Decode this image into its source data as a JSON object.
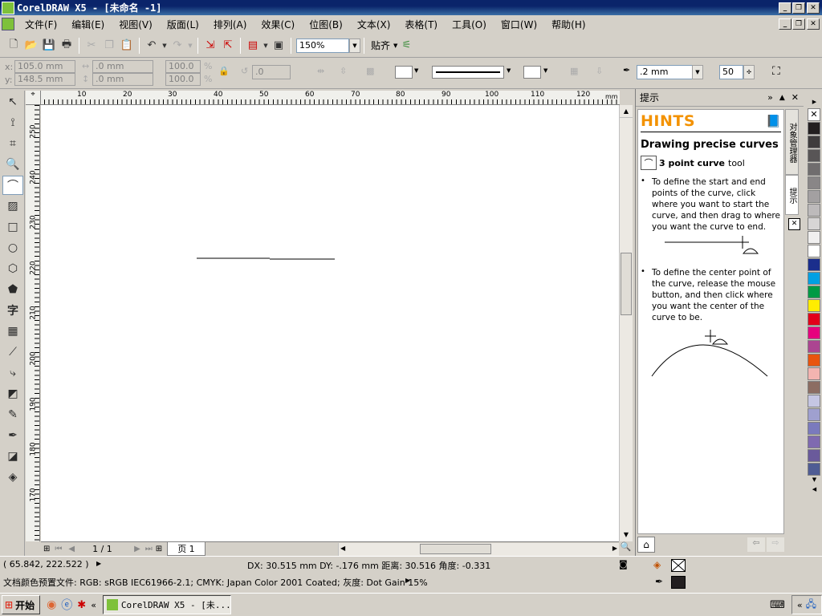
{
  "window": {
    "title": "CorelDRAW X5 - [未命名 -1]"
  },
  "menu": [
    "文件(F)",
    "编辑(E)",
    "视图(V)",
    "版面(L)",
    "排列(A)",
    "效果(C)",
    "位图(B)",
    "文本(X)",
    "表格(T)",
    "工具(O)",
    "窗口(W)",
    "帮助(H)"
  ],
  "toolbar": {
    "zoom": "150%",
    "snap_label": "贴齐"
  },
  "propbar": {
    "x_label": "x:",
    "x": "105.0 mm",
    "y_label": "y:",
    "y": "148.5 mm",
    "w": ".0 mm",
    "h": ".0 mm",
    "sx": "100.0",
    "sy": "100.0",
    "pct": "%",
    "angle": ".0",
    "outline_width": ".2 mm",
    "smoothing": "50"
  },
  "hruler": {
    "labels": [
      "10",
      "20",
      "30",
      "40",
      "50",
      "60",
      "70",
      "80",
      "90",
      "100",
      "110",
      "120",
      "mm"
    ]
  },
  "vruler": {
    "labels": [
      "250",
      "240",
      "230",
      "220",
      "210",
      "200",
      "190",
      "180",
      "170"
    ]
  },
  "pagenav": {
    "count": "1 / 1",
    "page_tab": "页 1"
  },
  "docker": {
    "title": "提示",
    "hints_heading": "HINTS",
    "hint_title": "Drawing precise curves",
    "tool_name": "3 point curve",
    "tool_suffix": "tool",
    "bullet1": "To define the start and end points of the curve, click where you want to start the curve, and then drag to where you want the curve to end.",
    "bullet2": "To define the center point of the curve, release the mouse button, and then click where you want the center of the curve to be.",
    "side_tab1": "对象管理器",
    "side_tab2": "提示"
  },
  "palette": [
    "#231f20",
    "#3f3c3d",
    "#585556",
    "#706d6e",
    "#898687",
    "#a3a0a1",
    "#bdbabb",
    "#d7d5d5",
    "#f0efef",
    "#ffffff",
    "#1b2e8c",
    "#00a0e3",
    "#009a44",
    "#ffed00",
    "#e2001a",
    "#e6007e",
    "#ac4591",
    "#e8540e",
    "#f3b4b0",
    "#8c6d62",
    "#c5c6e3",
    "#9fa0cf",
    "#7a7abd",
    "#7f6ab0",
    "#6a5a9b",
    "#4f5c94"
  ],
  "status": {
    "coords": "( 65.842, 222.522 )",
    "measure": "DX: 30.515 mm DY: -.176 mm 距离: 30.516 角度: -0.331",
    "profile": "文档颜色预置文件: RGB: sRGB IEC61966-2.1; CMYK: Japan Color 2001 Coated; 灰度: Dot Gain 15%"
  },
  "taskbar": {
    "start": "开始",
    "task": "CorelDRAW X5 - [未..."
  }
}
